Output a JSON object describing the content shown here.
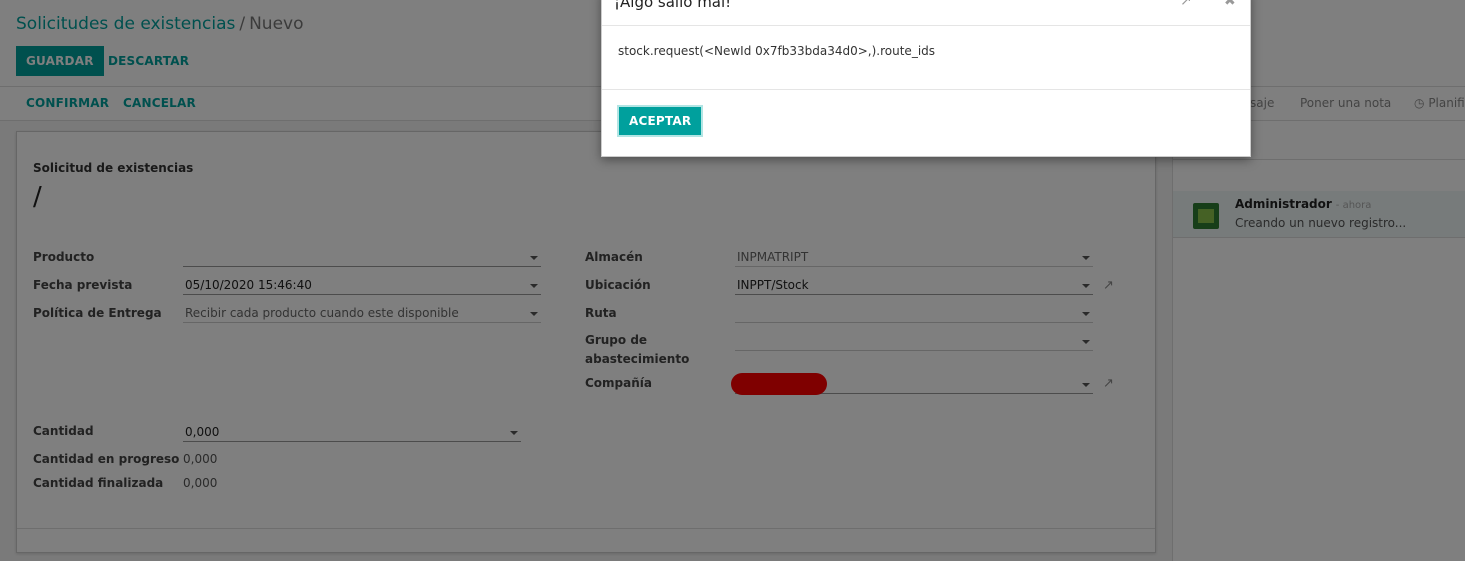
{
  "breadcrumb": {
    "parent": "Solicitudes de existencias",
    "separator": "/",
    "current": "Nuevo"
  },
  "toolbar": {
    "save_label": "GUARDAR",
    "discard_label": "DESCARTAR"
  },
  "statusbar": {
    "confirm_label": "CONFIRMAR",
    "cancel_label": "CANCELAR"
  },
  "chatter": {
    "send_message_label": "saje",
    "log_note_label": "Poner una nota",
    "schedule_label": "Planifi",
    "schedule_icon": "clock-icon",
    "message": {
      "author": "Administrador",
      "time": "- ahora",
      "body": "Creando un nuevo registro..."
    }
  },
  "form": {
    "section_label": "Solicitud de existencias",
    "name": "/",
    "left": {
      "product_label": "Producto",
      "product_value": "",
      "date_label": "Fecha prevista",
      "date_value": "05/10/2020 15:46:40",
      "policy_label": "Política de Entrega",
      "policy_value": "Recibir cada producto cuando este disponible"
    },
    "right": {
      "warehouse_label": "Almacén",
      "warehouse_value": "INPMATRIPT",
      "location_label": "Ubicación",
      "location_value": "INPPT/Stock",
      "route_label": "Ruta",
      "route_value": "",
      "group_label_1": "Grupo de",
      "group_label_2": "abastecimiento",
      "group_value": "",
      "company_label": "Compañía",
      "company_value": ""
    },
    "qty": {
      "qty_label": "Cantidad",
      "qty_value": "0,000",
      "progress_label": "Cantidad en progreso",
      "progress_value": "0,000",
      "done_label": "Cantidad finalizada",
      "done_value": "0,000"
    }
  },
  "dialog": {
    "title": "¡Algo salió mal!",
    "message": "stock.request(<NewId 0x7fb33bda34d0>,).route_ids",
    "accept_label": "ACEPTAR",
    "expand_icon": "expand-icon",
    "close_icon": "close-icon"
  },
  "colors": {
    "brand": "#00a09d",
    "redaction": "#ff0000"
  }
}
